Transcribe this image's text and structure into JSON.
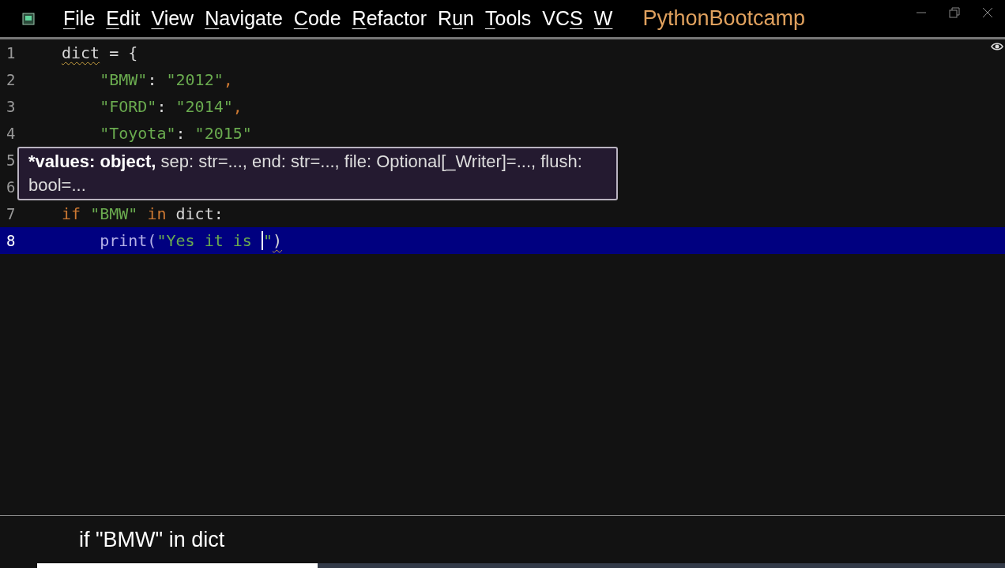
{
  "menubar": {
    "menus": [
      {
        "parts": [
          {
            "text": "F",
            "underlined": true
          },
          {
            "text": "ile",
            "underlined": false
          }
        ]
      },
      {
        "parts": [
          {
            "text": "E",
            "underlined": true
          },
          {
            "text": "dit",
            "underlined": false
          }
        ]
      },
      {
        "parts": [
          {
            "text": "V",
            "underlined": true
          },
          {
            "text": "iew",
            "underlined": false
          }
        ]
      },
      {
        "parts": [
          {
            "text": "N",
            "underlined": true
          },
          {
            "text": "avigate",
            "underlined": false
          }
        ]
      },
      {
        "parts": [
          {
            "text": "C",
            "underlined": true
          },
          {
            "text": "ode",
            "underlined": false
          }
        ]
      },
      {
        "parts": [
          {
            "text": "R",
            "underlined": true
          },
          {
            "text": "efactor",
            "underlined": false
          }
        ]
      },
      {
        "parts": [
          {
            "text": "R",
            "underlined": false
          },
          {
            "text": "u",
            "underlined": true
          },
          {
            "text": "n",
            "underlined": false
          }
        ]
      },
      {
        "parts": [
          {
            "text": "T",
            "underlined": true
          },
          {
            "text": "ools",
            "underlined": false
          }
        ]
      },
      {
        "parts": [
          {
            "text": "VC",
            "underlined": false
          },
          {
            "text": "S",
            "underlined": true
          }
        ]
      },
      {
        "parts": [
          {
            "text": "W",
            "underlined": true
          }
        ]
      }
    ],
    "project": "PythonBootcamp"
  },
  "editor": {
    "lines": [
      {
        "number": "1",
        "selected": false,
        "tokens": [
          {
            "kind": "warn",
            "text": "dict"
          },
          {
            "kind": "text",
            "text": " = {"
          }
        ]
      },
      {
        "number": "2",
        "selected": false,
        "tokens": [
          {
            "kind": "string",
            "text": "    \"BMW\""
          },
          {
            "kind": "text",
            "text": ": "
          },
          {
            "kind": "string",
            "text": "\"2012\""
          },
          {
            "kind": "comma",
            "text": ","
          }
        ]
      },
      {
        "number": "3",
        "selected": false,
        "tokens": [
          {
            "kind": "string",
            "text": "    \"FORD\""
          },
          {
            "kind": "text",
            "text": ": "
          },
          {
            "kind": "string",
            "text": "\"2014\""
          },
          {
            "kind": "comma",
            "text": ","
          }
        ]
      },
      {
        "number": "4",
        "selected": false,
        "tokens": [
          {
            "kind": "string",
            "text": "    \"Toyota\""
          },
          {
            "kind": "text",
            "text": ": "
          },
          {
            "kind": "string",
            "text": "\"2015\""
          }
        ]
      },
      {
        "number": "5",
        "selected": false
      },
      {
        "number": "6",
        "selected": false
      },
      {
        "number": "7",
        "selected": false,
        "tokens": [
          {
            "kind": "keyword",
            "text": "if"
          },
          {
            "kind": "string",
            "text": " \"BMW\" "
          },
          {
            "kind": "keyword",
            "text": "in"
          },
          {
            "kind": "text",
            "text": " dict:"
          }
        ]
      },
      {
        "number": "8",
        "selected": true,
        "tokens": [
          {
            "kind": "builtin",
            "text": "    print("
          },
          {
            "kind": "string",
            "text": "\"Yes it is "
          },
          {
            "kind": "caret"
          },
          {
            "kind": "string",
            "text": "\""
          },
          {
            "kind": "warn",
            "text": ")"
          }
        ]
      }
    ],
    "tooltip": {
      "highlighted": "*values: object,",
      "text": "sep: str=..., end: str=..., file: Optional[_Writer]=..., flush: bool=..."
    }
  },
  "caption": "if \"BMW\" in dict",
  "video_progress": {
    "level": 0.29
  }
}
